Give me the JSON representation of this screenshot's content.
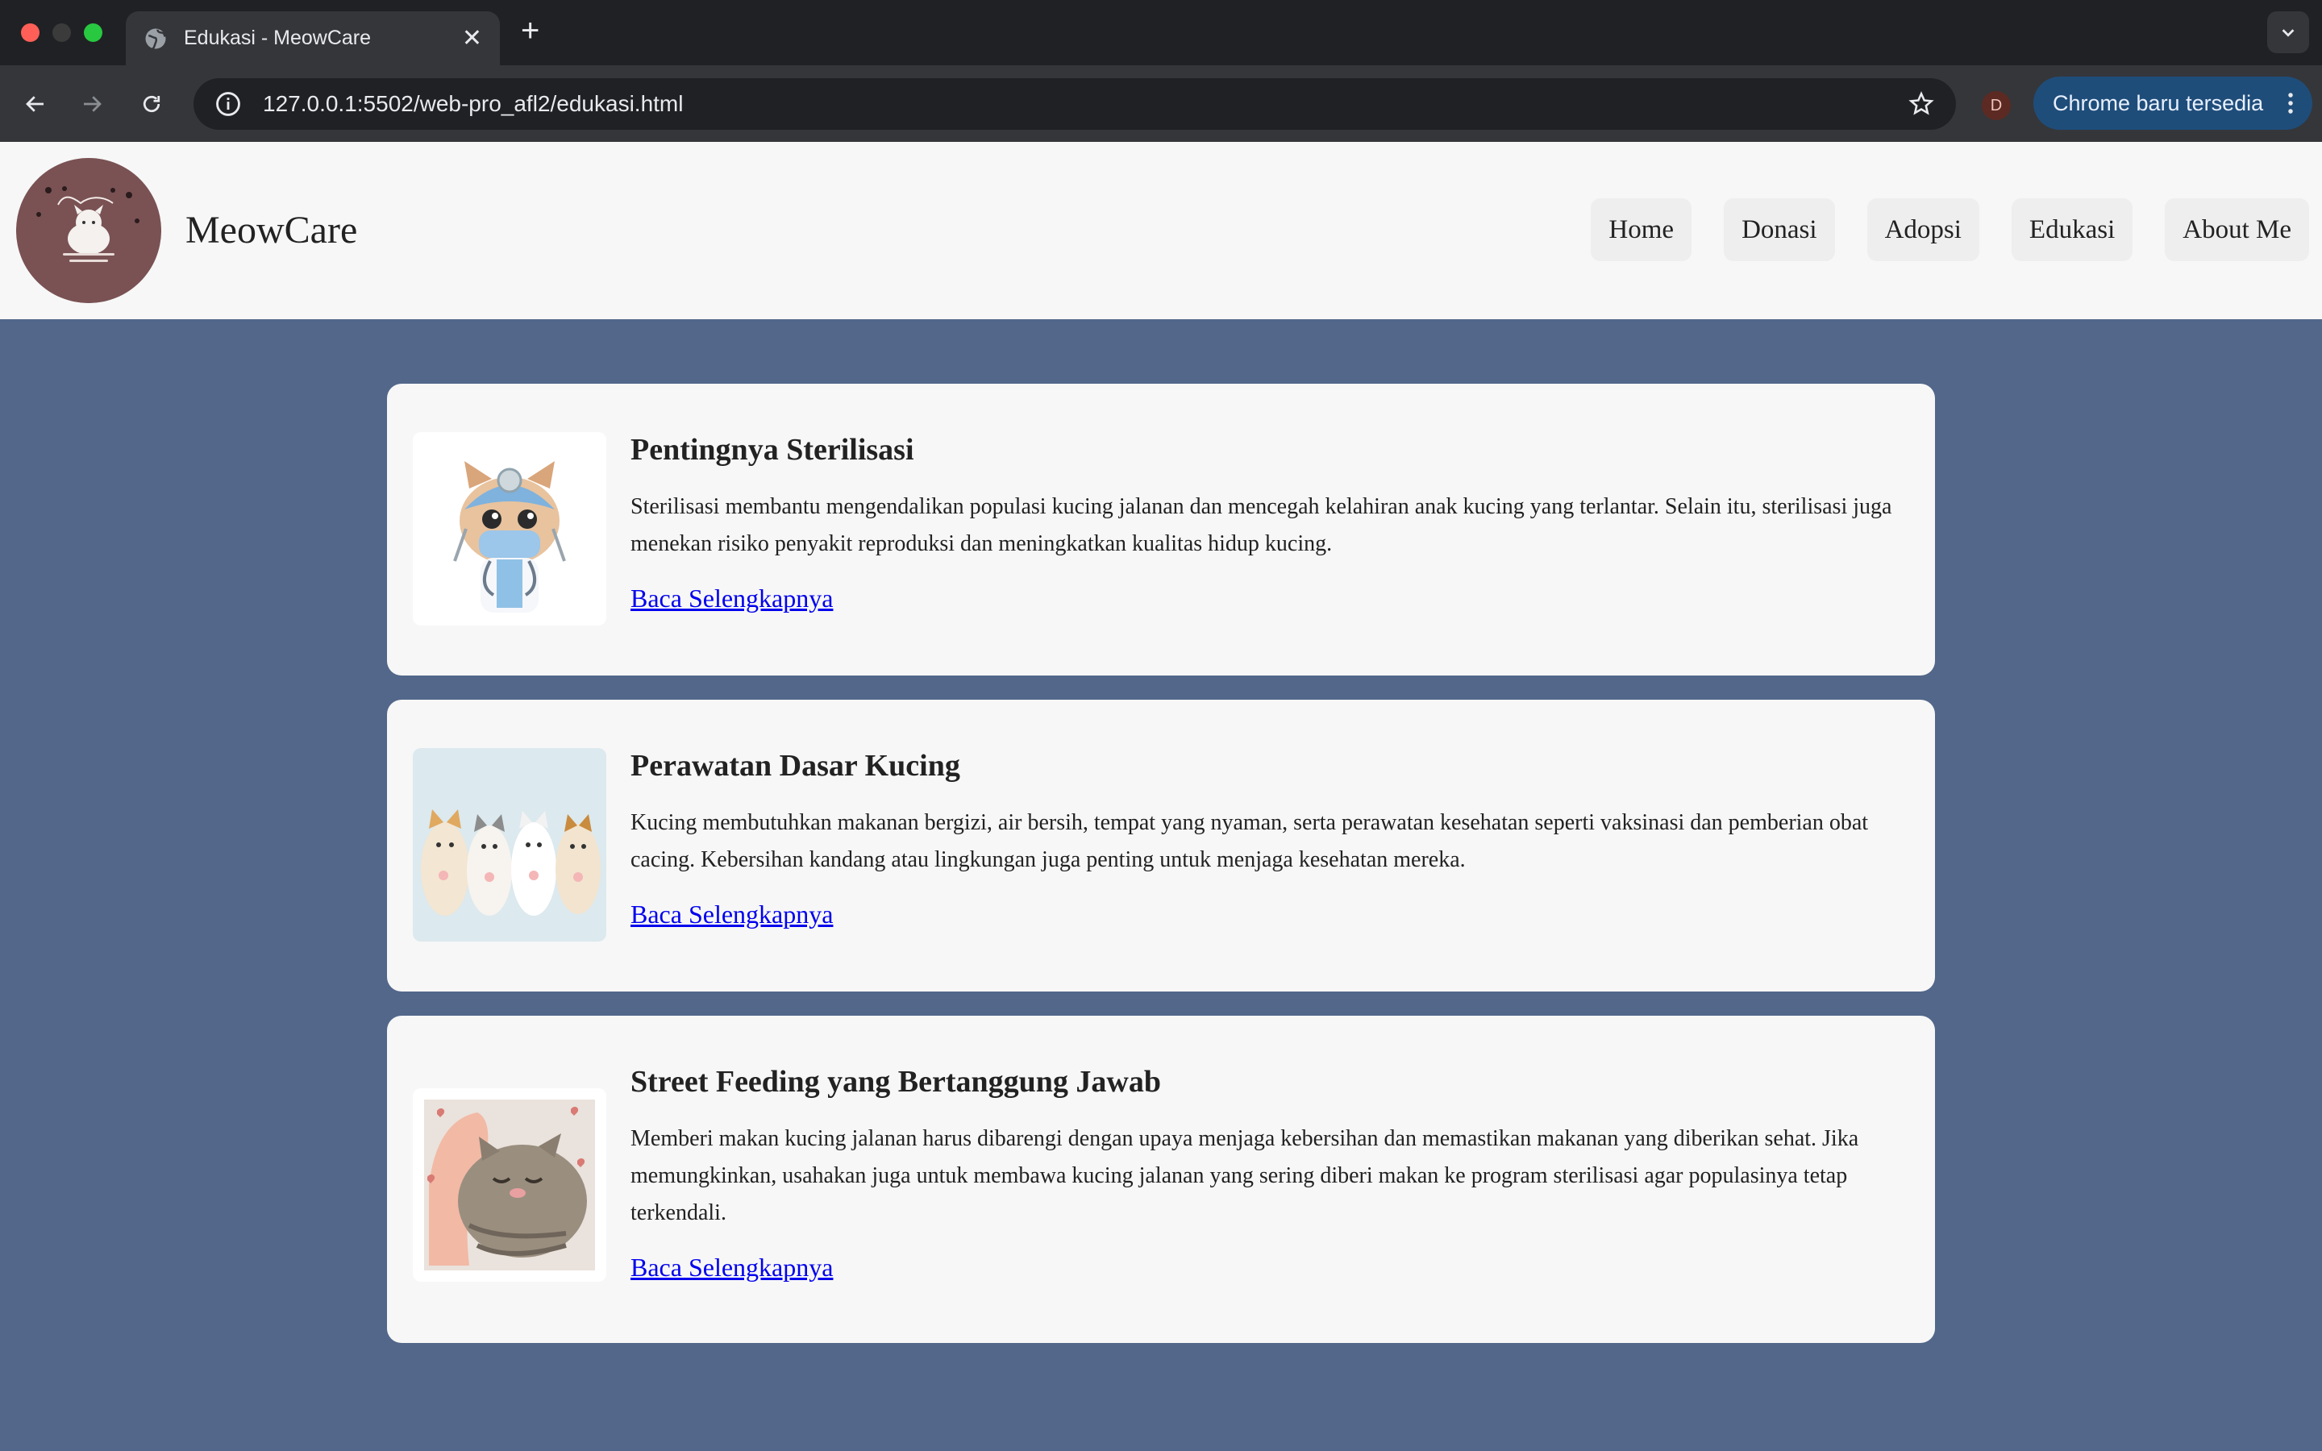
{
  "browser": {
    "tab_title": "Edukasi - MeowCare",
    "url": "127.0.0.1:5502/web-pro_afl2/edukasi.html",
    "profile_initial": "D",
    "update_label": "Chrome baru tersedia"
  },
  "site": {
    "brand": "MeowCare",
    "nav": [
      "Home",
      "Donasi",
      "Adopsi",
      "Edukasi",
      "About Me"
    ]
  },
  "articles": [
    {
      "title": "Pentingnya Sterilisasi",
      "body": "Sterilisasi membantu mengendalikan populasi kucing jalanan dan mencegah kelahiran anak kucing yang terlantar. Selain itu, sterilisasi juga menekan risiko penyakit reproduksi dan meningkatkan kualitas hidup kucing.",
      "link": "Baca Selengkapnya"
    },
    {
      "title": "Perawatan Dasar Kucing",
      "body": "Kucing membutuhkan makanan bergizi, air bersih, tempat yang nyaman, serta perawatan kesehatan seperti vaksinasi dan pemberian obat cacing. Kebersihan kandang atau lingkungan juga penting untuk menjaga kesehatan mereka.",
      "link": "Baca Selengkapnya"
    },
    {
      "title": "Street Feeding yang Bertanggung Jawab",
      "body": "Memberi makan kucing jalanan harus dibarengi dengan upaya menjaga kebersihan dan memastikan makanan yang diberikan sehat. Jika memungkinkan, usahakan juga untuk membawa kucing jalanan yang sering diberi makan ke program sterilisasi agar populasinya tetap terkendali.",
      "link": "Baca Selengkapnya"
    }
  ],
  "colors": {
    "page_bg": "#52678a",
    "card_bg": "#f7f7f7",
    "link": "#0000ee"
  },
  "icons": [
    "globe-icon",
    "close-icon",
    "plus-icon",
    "chevron-down-icon",
    "back-arrow-icon",
    "forward-arrow-icon",
    "reload-icon",
    "site-info-icon",
    "star-icon",
    "kebab-menu-icon"
  ]
}
